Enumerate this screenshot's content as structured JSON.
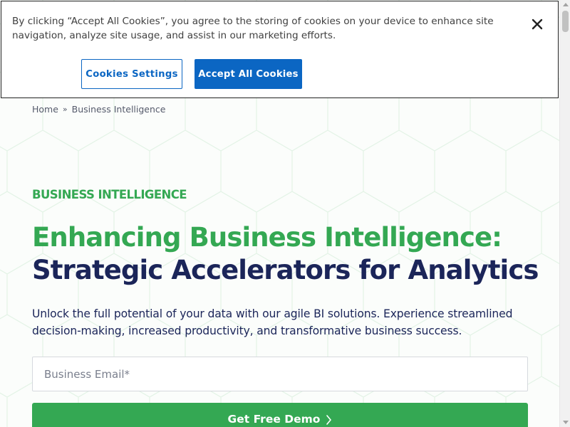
{
  "cookie_banner": {
    "text": "By clicking “Accept All Cookies”, you agree to the storing of cookies on your device to enhance site navigation, analyze site usage, and assist in our marketing efforts.",
    "settings_label": "Cookies Settings",
    "accept_label": "Accept All Cookies",
    "close_icon": "close-icon"
  },
  "breadcrumb": {
    "home": "Home",
    "separator": "»",
    "current": "Business Intelligence"
  },
  "hero": {
    "eyebrow": "BUSINESS INTELLIGENCE",
    "headline_line1": "Enhancing Business Intelligence:",
    "headline_line2": "Strategic Accelerators for Analytics",
    "subtext": "Unlock the full potential of your data with our agile BI solutions. Experience streamlined decision-making, increased productivity, and transformative business success.",
    "email_placeholder": "Business Email*",
    "demo_button_label": "Get Free Demo",
    "demo_button_icon": "chevron-right-icon"
  },
  "colors": {
    "accent_green": "#34a853",
    "navy": "#1b2559",
    "cookie_blue": "#0b66c3"
  }
}
